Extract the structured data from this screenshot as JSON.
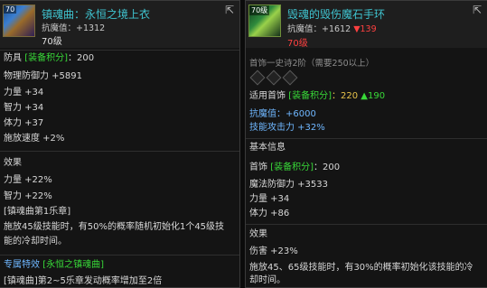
{
  "left": {
    "icon_level": "70",
    "title": "镇魂曲：永恒之境上衣",
    "sub_label": "抗魔值：",
    "sub_value": "+1312",
    "level": "70级",
    "type_label": "防具",
    "score_tag": "[装备积分]",
    "score_value": "：200",
    "stats": [
      "物理防御力 +5891",
      "力量 +34",
      "智力 +34",
      "体力 +37",
      "施放速度 +2%"
    ],
    "effect_title": "效果",
    "effects": [
      "力量 +22%",
      "智力 +22%"
    ],
    "chapter": "[镇魂曲第1乐章]",
    "chapter_text_1": "施放45级技能时，有50%的概率随机初始化1个45级技",
    "chapter_text_2": "能的冷却时间。",
    "special_label": "专属特效",
    "special_tag": "[永恒之镇魂曲]",
    "special_text": "[镇魂曲]第2~5乐章发动概率增加至2倍"
  },
  "right": {
    "icon_level": "70级",
    "title": "毁魂的毁伤魔石手环",
    "sub_label": "抗魔值：",
    "sub_value": "+1612",
    "sub_down": "▼139",
    "level": "70级",
    "slots_text": "首饰一史诗2阶（需要250以上）",
    "suit_label": "适用首饰",
    "suit_tag": "[装备积分]",
    "suit_value": "：220",
    "suit_up": "▲190",
    "bonus": [
      "抗魔值：+6000",
      "技能攻击力 +32%"
    ],
    "base_title": "基本信息",
    "base_type": "首饰",
    "base_tag": "[装备积分]",
    "base_value": "：200",
    "base_stats": [
      "魔法防御力 +3533",
      "力量 +34",
      "体力 +86"
    ],
    "effect_title": "效果",
    "effects": [
      "伤害 +23%"
    ],
    "effect_text_1": "施放45、65级技能时，有30%的概率初始化该技能的冷",
    "effect_text_2": "却时间。"
  },
  "icons": {
    "expand": "expand-icon",
    "item_left": "armor-item-icon",
    "item_right": "bracelet-item-icon",
    "slot": "diamond-slot-icon"
  },
  "colors": {
    "title": "#3fc3cf",
    "tag": "#38d938",
    "score": "#e8c34a",
    "bonus": "#6fb7ff",
    "down": "#ff4040"
  }
}
